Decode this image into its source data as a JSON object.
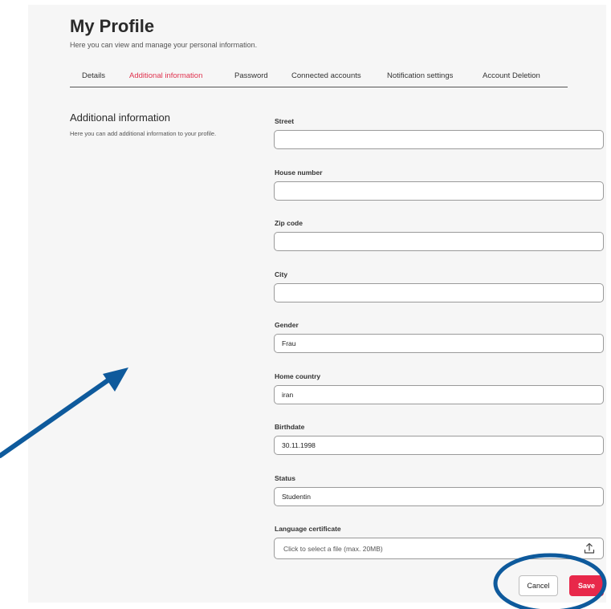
{
  "header": {
    "title": "My Profile",
    "subtitle": "Here you can view and manage your personal information."
  },
  "tabs": [
    {
      "label": "Details",
      "active": false
    },
    {
      "label": "Additional information",
      "active": true
    },
    {
      "label": "Password",
      "active": false
    },
    {
      "label": "Connected accounts",
      "active": false
    },
    {
      "label": "Notification settings",
      "active": false
    },
    {
      "label": "Account Deletion",
      "active": false
    }
  ],
  "section": {
    "title": "Additional information",
    "description": "Here you can add additional information to your profile."
  },
  "fields": {
    "street": {
      "label": "Street",
      "value": ""
    },
    "house_number": {
      "label": "House number",
      "value": ""
    },
    "zip_code": {
      "label": "Zip code",
      "value": ""
    },
    "city": {
      "label": "City",
      "value": ""
    },
    "gender": {
      "label": "Gender",
      "value": "Frau"
    },
    "home_country": {
      "label": "Home country",
      "value": "iran"
    },
    "birthdate": {
      "label": "Birthdate",
      "value": "30.11.1998"
    },
    "status": {
      "label": "Status",
      "value": "Studentin"
    },
    "language_certificate": {
      "label": "Language certificate",
      "placeholder": "Click to select a file (max. 20MB)",
      "icon": "upload-icon"
    }
  },
  "actions": {
    "cancel_label": "Cancel",
    "save_label": "Save"
  },
  "colors": {
    "accent": "#e0324e",
    "save_button": "#e8284a",
    "annotation": "#0e5a9c",
    "page_background": "#f6f6f6"
  }
}
